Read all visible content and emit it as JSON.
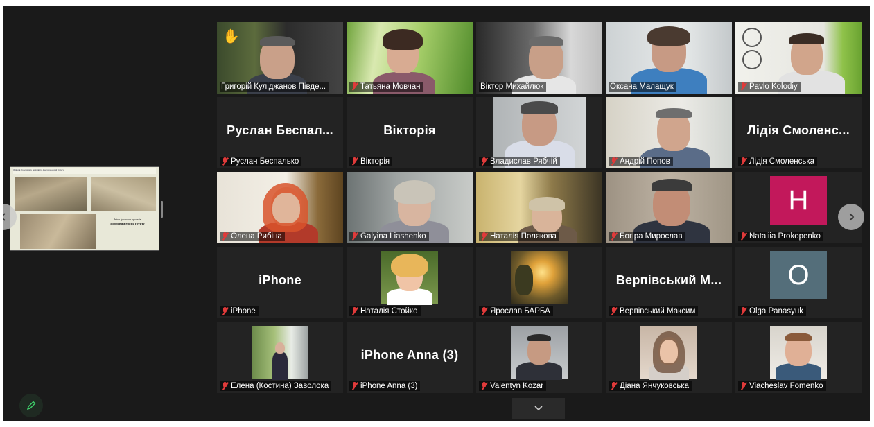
{
  "shared_screen": {
    "title": "Зміни в ґрунтовому покриві та фактори ерозії ґрунту",
    "caption_line": "Зміна ґрунтових процесів",
    "caption_bold": "Бомбовим ерозія ґрунту"
  },
  "participants": [
    {
      "name": "Григорій Кулiджанов Півде...",
      "muted": false,
      "video": true,
      "hand_raised": true,
      "active_speaker": true
    },
    {
      "name": "Татьяна Мовчан",
      "muted": true,
      "video": true
    },
    {
      "name": "Віктор Михайлюк",
      "muted": false,
      "video": true
    },
    {
      "name": "Оксана Малащук",
      "muted": false,
      "video": true
    },
    {
      "name": "Pavlo Kolodiy",
      "muted": true,
      "video": true
    },
    {
      "name": "Руслан Беспалько",
      "display_text": "Руслан Беспал...",
      "muted": true,
      "video": false
    },
    {
      "name": "Вікторія",
      "display_text": "Вікторія",
      "muted": true,
      "video": false
    },
    {
      "name": "Владислав Рябчій",
      "muted": true,
      "video": true
    },
    {
      "name": "Андрій Попов",
      "muted": true,
      "video": true
    },
    {
      "name": "Лідія Смоленська",
      "display_text": "Лідія Смоленс...",
      "muted": true,
      "video": false
    },
    {
      "name": "Олена Рибіна",
      "muted": true,
      "video": true
    },
    {
      "name": "Galyina Liashenko",
      "muted": true,
      "video": true
    },
    {
      "name": "Наталія Полякова",
      "muted": true,
      "video": true
    },
    {
      "name": "Богіра Мирослав",
      "muted": true,
      "video": true
    },
    {
      "name": "Nataliia Prokopenko",
      "avatar_letter": "H",
      "avatar_color": "#c2185b",
      "muted": true,
      "video": false
    },
    {
      "name": "iPhone",
      "display_text": "iPhone",
      "muted": true,
      "video": false
    },
    {
      "name": "Наталія Стойко",
      "muted": true,
      "video": false
    },
    {
      "name": "Ярослав БАРБА",
      "muted": true,
      "video": false
    },
    {
      "name": "Верпівський Максим",
      "display_text": "Верпівський М...",
      "muted": true,
      "video": false
    },
    {
      "name": "Olga Panasyuk",
      "avatar_letter": "O",
      "avatar_color": "#546e7a",
      "muted": true,
      "video": false
    },
    {
      "name": "Елена (Костина) Заволока",
      "muted": true,
      "video": false
    },
    {
      "name": "iPhone Anna (3)",
      "display_text": "iPhone Anna (3)",
      "muted": true,
      "video": false
    },
    {
      "name": "Valentyn Kozar",
      "muted": true,
      "video": false
    },
    {
      "name": "Діана Янчуковська",
      "muted": true,
      "video": false
    },
    {
      "name": "Viacheslav Fomenko",
      "muted": true,
      "video": false
    }
  ],
  "icons": {
    "prev_page": "chevron-left-icon",
    "next_page": "chevron-right-icon",
    "annotate": "pencil-icon",
    "collapse": "chevron-down-icon"
  },
  "colors": {
    "active_speaker_border": "#e9e36a",
    "muted_mic": "#e03a3a",
    "tile_bg": "#232323",
    "window_bg": "#1a1a1a"
  }
}
